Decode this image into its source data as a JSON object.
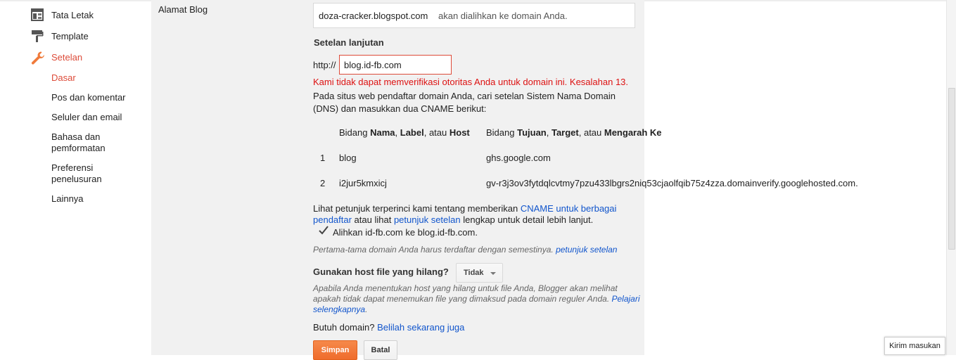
{
  "sidebar": {
    "items": [
      {
        "label": "Tata Letak",
        "icon": "layout-icon"
      },
      {
        "label": "Template",
        "icon": "paint-roller-icon"
      },
      {
        "label": "Setelan",
        "icon": "wrench-icon"
      }
    ],
    "subitems": [
      "Dasar",
      "Pos dan komentar",
      "Seluler dan email",
      "Bahasa dan pemformatan",
      "Preferensi penelusuran",
      "Lainnya"
    ]
  },
  "colors": {
    "accent": "#dd4b39",
    "link": "#1155cc",
    "error": "#dd1111",
    "save_button": "#f07a3a"
  },
  "blog_address": {
    "label": "Alamat Blog",
    "value": "doza-cracker.blogspot.com",
    "note": "akan dialihkan ke domain Anda."
  },
  "advanced": {
    "title": "Setelan lanjutan",
    "http_prefix": "http://",
    "domain_value": "blog.id-fb.com",
    "error": "Kami tidak dapat memverifikasi otoritas Anda untuk domain ini. Kesalahan 13.",
    "instructions": "Pada situs web pendaftar domain Anda, cari setelan Sistem Nama Domain (DNS) dan masukkan dua CNAME berikut:"
  },
  "cname_table": {
    "header_name": {
      "p1": "Bidang ",
      "b1": "Nama",
      "p2": ", ",
      "b2": "Label",
      "p3": ", atau ",
      "b3": "Host"
    },
    "header_target": {
      "p1": "Bidang ",
      "b1": "Tujuan",
      "p2": ", ",
      "b2": "Target",
      "p3": ", atau ",
      "b3": "Mengarah Ke"
    },
    "rows": [
      {
        "num": "1",
        "name": "blog",
        "target": "ghs.google.com"
      },
      {
        "num": "2",
        "name": "i2jur5kmxicj",
        "target": "gv-r3j3ov3fytdqlcvtmy7pzu433lbgrs2niq53cjaolfqib75z4zza.domainverify.googlehosted.com."
      }
    ]
  },
  "help": {
    "t1": "Lihat petunjuk terperinci kami tentang memberikan ",
    "link1": "CNAME untuk berbagai pendaftar",
    "t2": " atau lihat ",
    "link2": "petunjuk setelan",
    "t3": " lengkap untuk detail lebih lanjut."
  },
  "redirect": {
    "checked": true,
    "label": "Alihkan id-fb.com ke blog.id-fb.com."
  },
  "register_note": {
    "text": "Pertama-tama domain Anda harus terdaftar dengan semestinya. ",
    "link": "petunjuk setelan"
  },
  "missing_files": {
    "label": "Gunakan host file yang hilang?",
    "selected": "Tidak",
    "help": "Apabila Anda menentukan host yang hilang untuk file Anda, Blogger akan melihat apakah tidak dapat menemukan file yang dimaksud pada domain reguler Anda. ",
    "link": "Pelajari selengkapnya",
    "help_end": "."
  },
  "buy_domain": {
    "text": "Butuh domain? ",
    "link": "Belilah sekarang juga"
  },
  "buttons": {
    "save": "Simpan",
    "cancel": "Batal"
  },
  "feedback": "Kirim masukan"
}
